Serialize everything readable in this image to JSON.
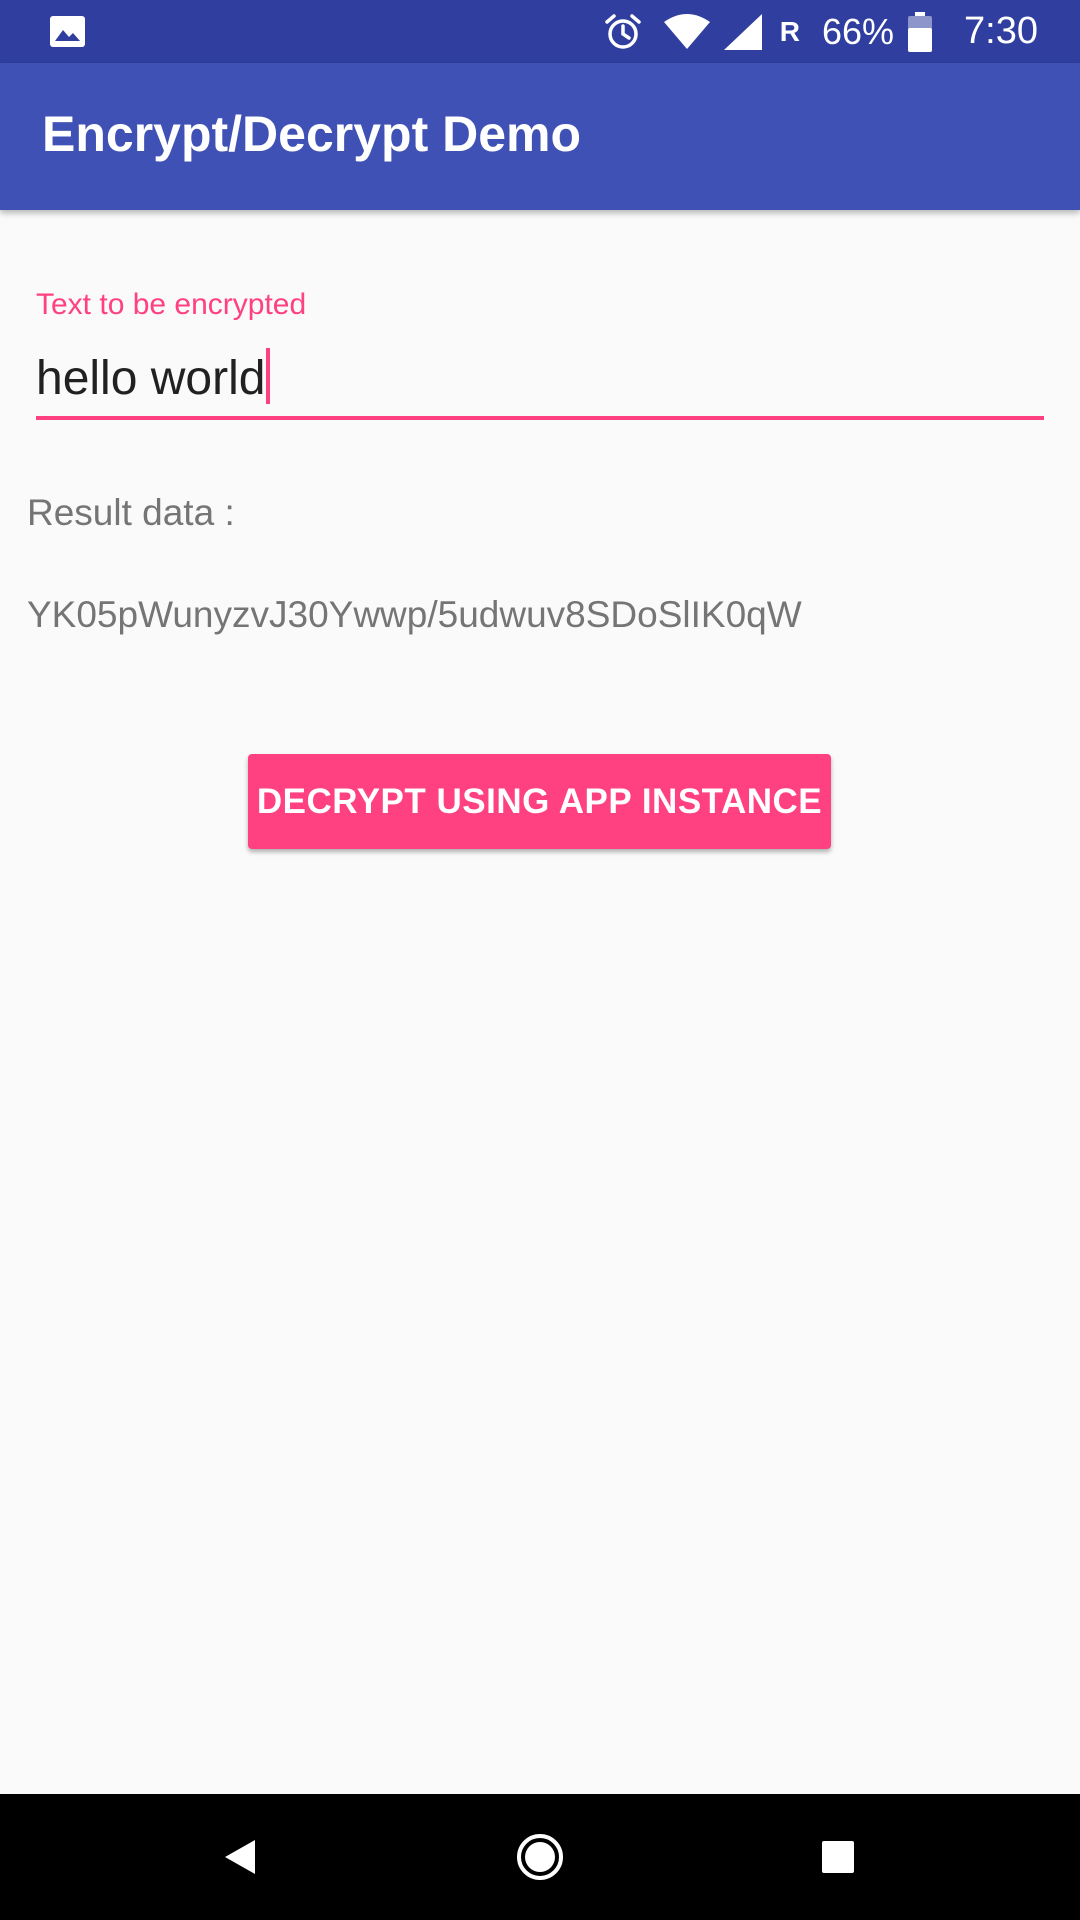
{
  "status_bar": {
    "icons": [
      "gallery-icon",
      "alarm-icon",
      "wifi-icon",
      "signal-icon",
      "battery-icon"
    ],
    "roaming": "R",
    "battery": "66%",
    "time": "7:30"
  },
  "app_bar": {
    "title": "Encrypt/Decrypt Demo"
  },
  "form": {
    "label": "Text to be encrypted",
    "value": "hello world"
  },
  "result": {
    "label": "Result data :",
    "value": "YK05pWunyzvJ30Ywwp/5udwuv8SDoSlIK0qW"
  },
  "actions": {
    "decrypt_label": "DECRYPT USING APP INSTANCE"
  },
  "nav_bar": {
    "icons": [
      "back-icon",
      "home-icon",
      "recents-icon"
    ]
  },
  "colors": {
    "status_bar": "#303f9f",
    "app_bar": "#3f51b5",
    "accent": "#ff4081",
    "background": "#fafafa",
    "secondary_text": "#757575"
  }
}
